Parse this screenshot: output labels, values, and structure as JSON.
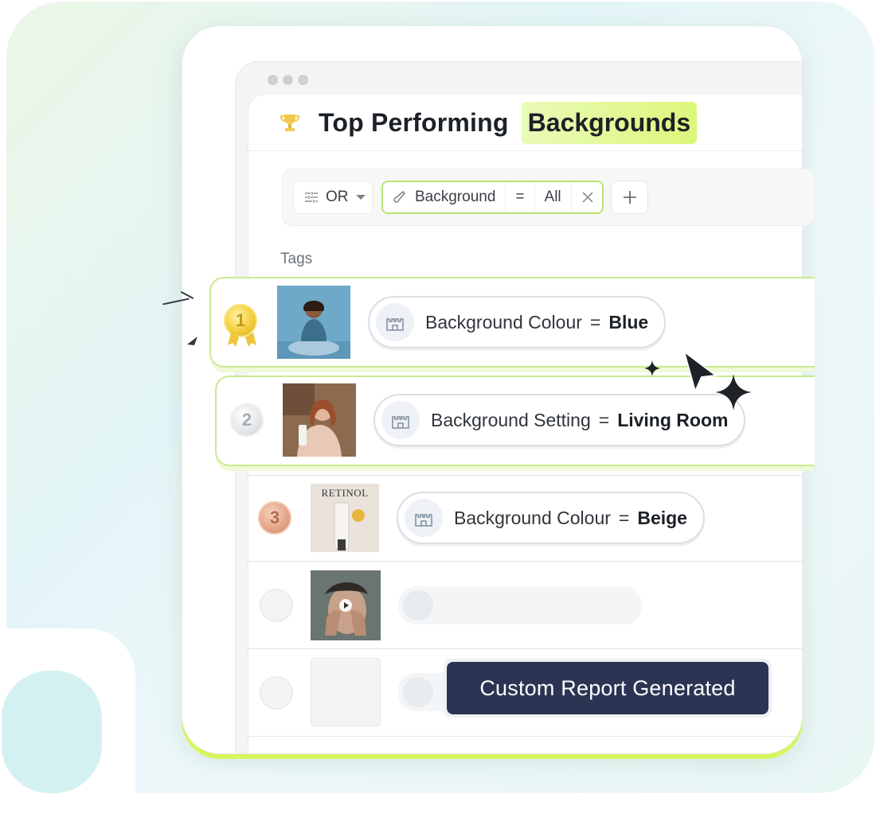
{
  "header": {
    "title": "Top Performing",
    "title_highlight": "Backgrounds"
  },
  "filters": {
    "logic": "OR",
    "field": "Background",
    "operator": "=",
    "value": "All"
  },
  "table": {
    "column_label": "Tags",
    "rows": [
      {
        "rank": "1",
        "medal": "gold",
        "tag_name": "Background Colour",
        "tag_operator": "=",
        "tag_value": "Blue",
        "highlighted": true
      },
      {
        "rank": "2",
        "medal": "silver",
        "tag_name": "Background Setting",
        "tag_operator": "=",
        "tag_value": "Living Room",
        "highlighted": true
      },
      {
        "rank": "3",
        "medal": "bronze",
        "tag_name": "Background Colour",
        "tag_operator": "=",
        "tag_value": "Beige",
        "highlighted": false,
        "thumb_text": "RETINOL"
      },
      {
        "rank": "",
        "medal": "none",
        "loading": true
      },
      {
        "rank": "",
        "medal": "none",
        "loading": true
      }
    ]
  },
  "toast": {
    "message": "Custom Report Generated"
  },
  "icons": {
    "trophy": "trophy-icon",
    "filter": "sliders-icon",
    "field": "paintbrush-icon",
    "remove": "close-icon",
    "add": "plus-icon",
    "tag": "castle-icon",
    "cursor": "pointer-cursor-icon",
    "video": "play-icon"
  },
  "colors": {
    "accent": "#d6f65a",
    "highlight_border": "#c9ea8e",
    "toast_bg": "#2b3553"
  }
}
